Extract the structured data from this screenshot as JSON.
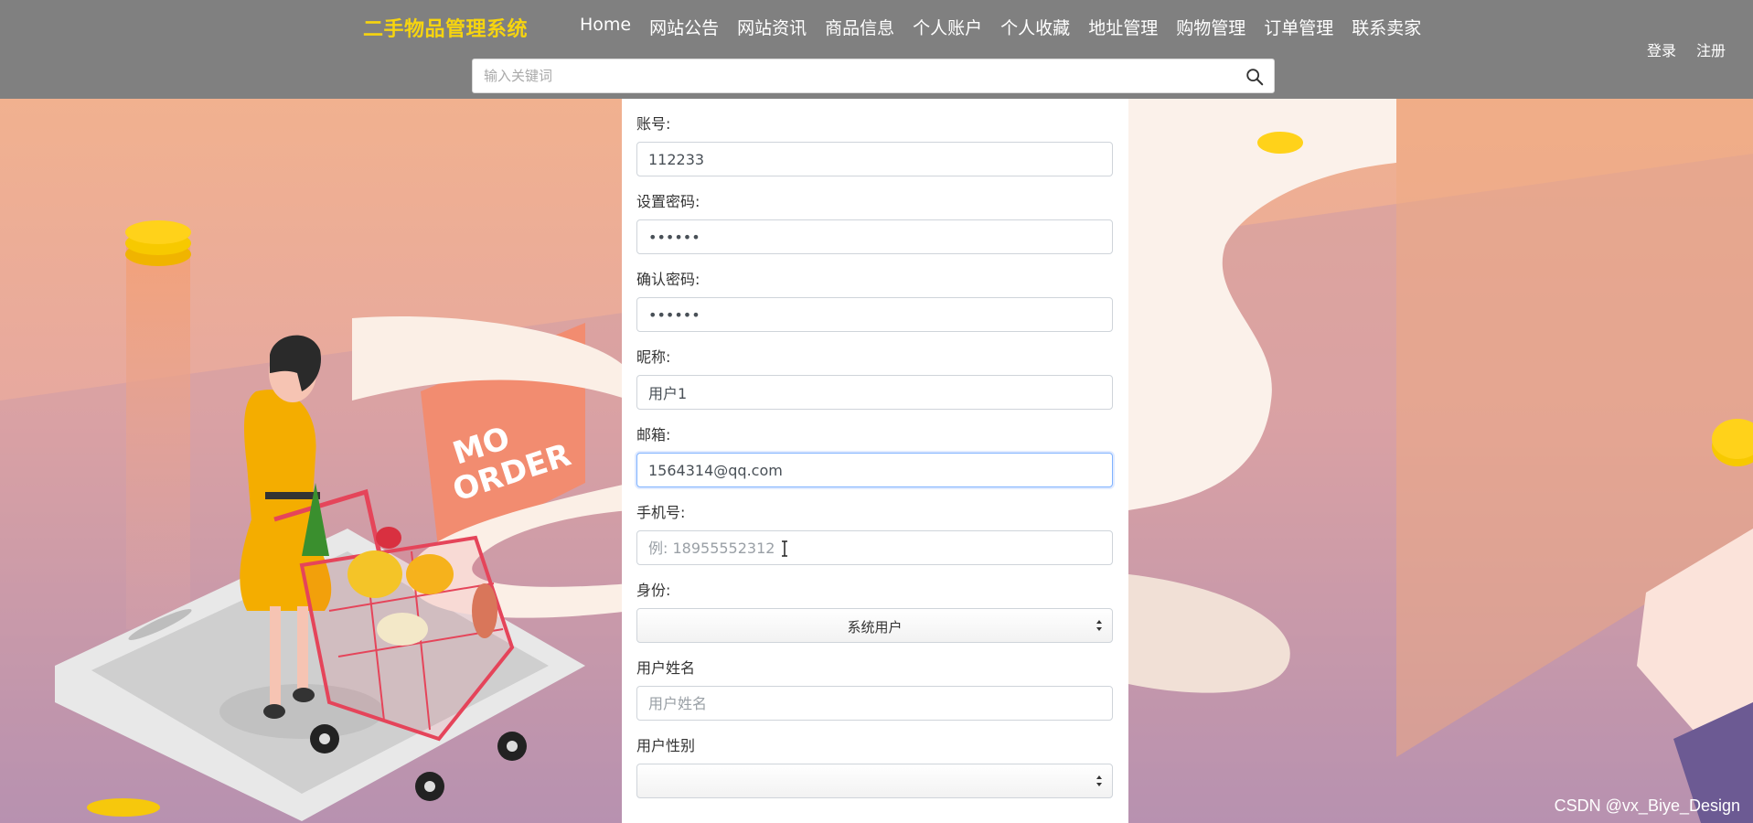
{
  "header": {
    "brand": "二手物品管理系统",
    "nav": [
      "Home",
      "网站公告",
      "网站资讯",
      "商品信息",
      "个人账户",
      "个人收藏",
      "地址管理",
      "购物管理",
      "订单管理",
      "联系卖家"
    ],
    "login": "登录",
    "register": "注册",
    "search_placeholder": "输入关键词"
  },
  "form": {
    "account_label": "账号:",
    "account_value": "112233",
    "password_label": "设置密码:",
    "password_value": "••••••",
    "confirm_label": "确认密码:",
    "confirm_value": "••••••",
    "nickname_label": "昵称:",
    "nickname_value": "用户1",
    "email_label": "邮箱:",
    "email_value": "1564314@qq.com",
    "phone_label": "手机号:",
    "phone_placeholder": "例: 18955552312",
    "identity_label": "身份:",
    "identity_value": "系统用户",
    "username_label": "用户姓名",
    "username_placeholder": "用户姓名",
    "gender_label": "用户性别",
    "gender_value": ""
  },
  "illustration": {
    "sign_text_1": "MO",
    "sign_text_2": "ORDER"
  },
  "watermark": "CSDN @vx_Biye_Design",
  "colors": {
    "header_bg": "#808080",
    "brand": "#f6d40f",
    "focus_border": "#80b3ff"
  }
}
